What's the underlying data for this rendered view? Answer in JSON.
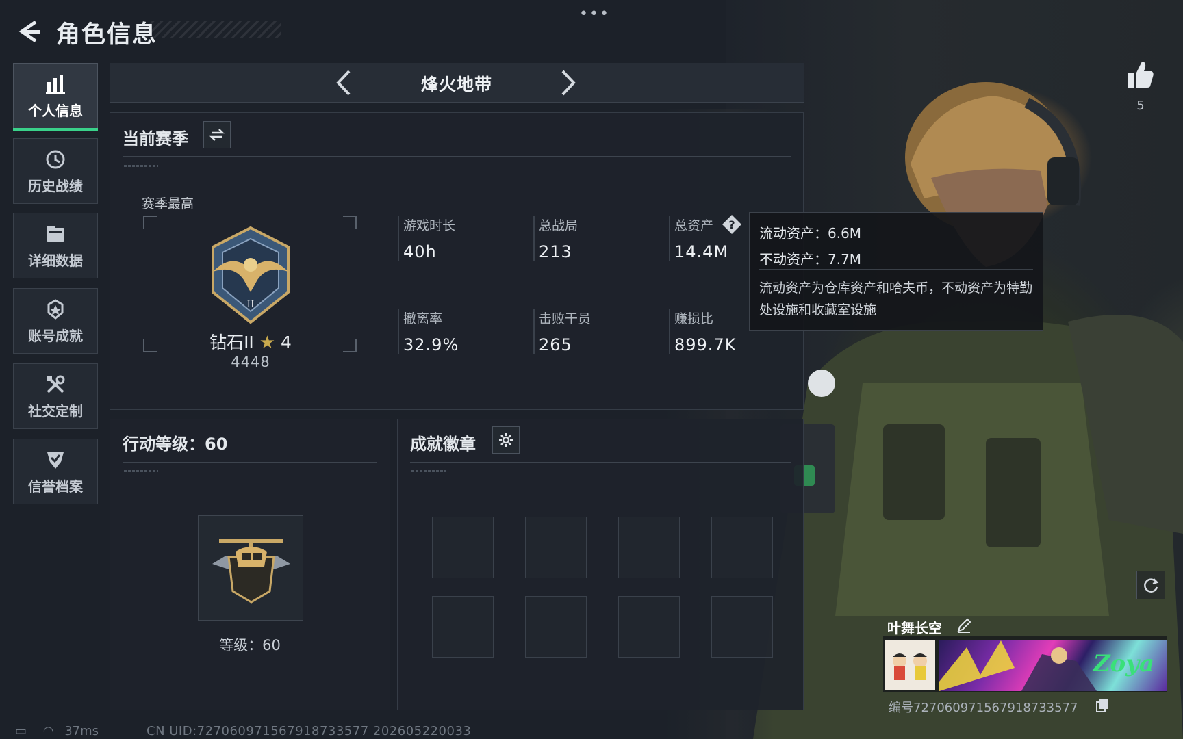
{
  "header": {
    "title": "角色信息",
    "more_label": "•••"
  },
  "sidebar": {
    "items": [
      {
        "label": "个人信息",
        "icon": "bar-chart-icon",
        "active": true
      },
      {
        "label": "历史战绩",
        "icon": "history-clock-icon"
      },
      {
        "label": "详细数据",
        "icon": "folder-icon"
      },
      {
        "label": "账号成就",
        "icon": "achievement-medal-icon"
      },
      {
        "label": "社交定制",
        "icon": "tools-icon"
      },
      {
        "label": "信誉档案",
        "icon": "shield-check-icon"
      }
    ]
  },
  "mode": {
    "title": "烽火地带"
  },
  "season": {
    "heading": "当前赛季",
    "best_label": "赛季最高",
    "rank_name": "钻石II",
    "rank_stars": "4",
    "rank_points": "4448",
    "stats": [
      {
        "key": "游戏时长",
        "value": "40h"
      },
      {
        "key": "总战局",
        "value": "213"
      },
      {
        "key": "总资产",
        "value": "14.4M"
      },
      {
        "key": "撤离率",
        "value": "32.9%"
      },
      {
        "key": "击败干员",
        "value": "265"
      },
      {
        "key": "赚损比",
        "value": "899.7K"
      }
    ]
  },
  "tooltip": {
    "liquid": "流动资产：6.6M",
    "fixed": "不动资产：7.7M",
    "description": "流动资产为仓库资产和哈夫币，不动资产为特勤处设施和收藏室设施"
  },
  "action_level": {
    "heading": "行动等级：60",
    "level_text": "等级：60"
  },
  "badges": {
    "heading": "成就徽章"
  },
  "profile": {
    "like_count": "5",
    "player_name": "叶舞长空",
    "uid_label": "编号",
    "uid_value": "727060971567918733577",
    "banner_text": "Zoya"
  },
  "status": {
    "ping": "37ms",
    "footer_uid": "CN UID:727060971567918733577 202605220033"
  },
  "colors": {
    "accent_green": "#3ad18a",
    "rank_star": "#c8a94e",
    "background": "#1c2129"
  }
}
